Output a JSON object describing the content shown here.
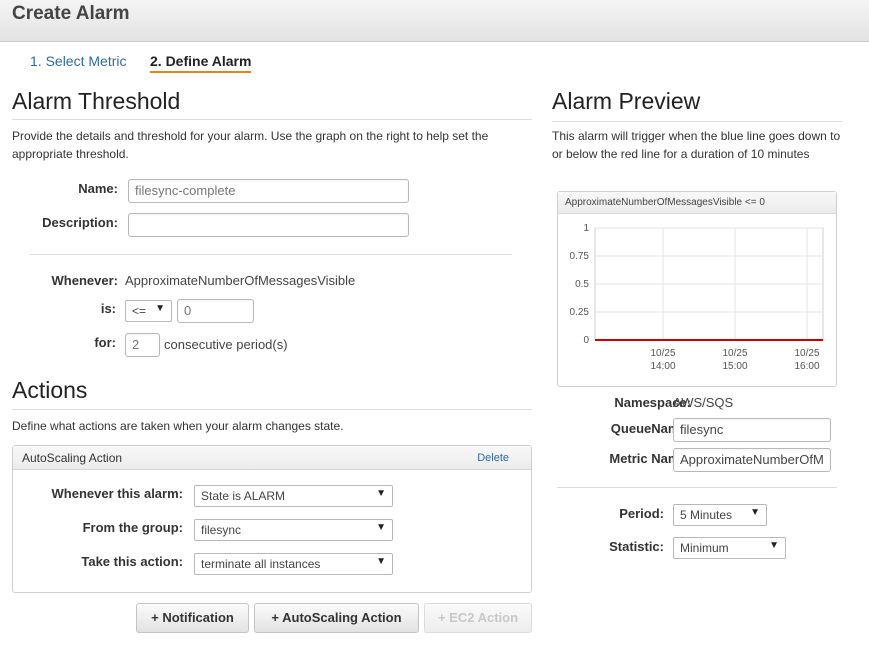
{
  "header": {
    "title": "Create Alarm"
  },
  "steps": [
    {
      "label": "1. Select Metric"
    },
    {
      "label": "2. Define Alarm"
    }
  ],
  "threshold": {
    "title": "Alarm Threshold",
    "description": "Provide the details and threshold for your alarm. Use the graph on the right to help set the appropriate threshold.",
    "name_label": "Name:",
    "name_value": "filesync-complete",
    "description_label": "Description:",
    "description_value": "",
    "whenever_label": "Whenever:",
    "whenever_value": "ApproximateNumberOfMessagesVisible",
    "is_label": "is:",
    "operator": "<=",
    "threshold_value": "0",
    "for_label": "for:",
    "periods_value": "2",
    "periods_suffix": "consecutive period(s)"
  },
  "actions": {
    "title": "Actions",
    "description": "Define what actions are taken when your alarm changes state.",
    "panel_title": "AutoScaling Action",
    "delete_label": "Delete",
    "whenever_alarm_label": "Whenever this alarm:",
    "whenever_alarm_value": "State is ALARM",
    "group_label": "From the group:",
    "group_value": "filesync",
    "take_action_label": "Take this action:",
    "take_action_value": "terminate all instances",
    "buttons": {
      "notification": "+ Notification",
      "autoscaling": "+ AutoScaling Action",
      "ec2": "+ EC2 Action"
    }
  },
  "preview": {
    "title": "Alarm Preview",
    "description": "This alarm will trigger when the blue line goes down to or below the red line for a duration of 10 minutes",
    "chart_title": "ApproximateNumberOfMessagesVisible <= 0",
    "namespace_label": "Namespace:",
    "namespace_value": "AWS/SQS",
    "queuename_label": "QueueName:",
    "queuename_value": "filesync",
    "metric_label": "Metric Name:",
    "metric_value": "ApproximateNumberOfM",
    "period_label": "Period:",
    "period_value": "5 Minutes",
    "statistic_label": "Statistic:",
    "statistic_value": "Minimum"
  },
  "colors": {
    "threshold_line": "#cc0000",
    "tab_underline": "#e8821c",
    "link": "#2e6ba8"
  },
  "chart_data": {
    "type": "line",
    "title": "ApproximateNumberOfMessagesVisible <= 0",
    "y_ticks": [
      "1",
      "0.75",
      "0.5",
      "0.25",
      "0"
    ],
    "x_ticks": [
      {
        "date": "10/25",
        "time": "14:00"
      },
      {
        "date": "10/25",
        "time": "15:00"
      },
      {
        "date": "10/25",
        "time": "16:00"
      }
    ],
    "ylim": [
      0,
      1
    ],
    "series": [
      {
        "values": [
          0,
          0,
          0,
          0
        ],
        "color": "#cc0000"
      }
    ],
    "grid": true
  }
}
